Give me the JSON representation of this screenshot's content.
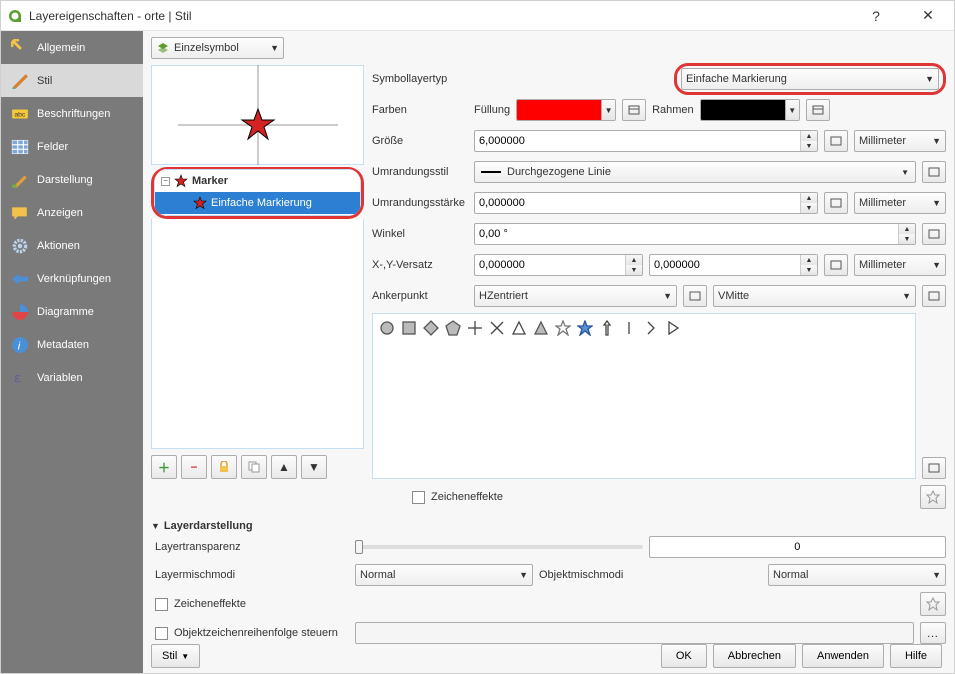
{
  "window_title": "Layereigenschaften - orte | Stil",
  "sidebar": {
    "items": [
      {
        "label": "Allgemein"
      },
      {
        "label": "Stil"
      },
      {
        "label": "Beschriftungen"
      },
      {
        "label": "Felder"
      },
      {
        "label": "Darstellung"
      },
      {
        "label": "Anzeigen"
      },
      {
        "label": "Aktionen"
      },
      {
        "label": "Verknüpfungen"
      },
      {
        "label": "Diagramme"
      },
      {
        "label": "Metadaten"
      },
      {
        "label": "Variablen"
      }
    ],
    "active_index": 1
  },
  "symbol_mode": "Einzelsymbol",
  "tree": {
    "root": "Marker",
    "child": "Einfache Markierung"
  },
  "props": {
    "type_label": "Symbollayertyp",
    "type_value": "Einfache Markierung",
    "colors_label": "Farben",
    "fill_label": "Füllung",
    "fill_color": "#ff0000",
    "stroke_label": "Rahmen",
    "stroke_color": "#000000",
    "size_label": "Größe",
    "size_value": "6,000000",
    "size_unit": "Millimeter",
    "outline_style_label": "Umrandungsstil",
    "outline_style_value": "Durchgezogene Linie",
    "outline_width_label": "Umrandungsstärke",
    "outline_width_value": "0,000000",
    "outline_width_unit": "Millimeter",
    "angle_label": "Winkel",
    "angle_value": "0,00 °",
    "offset_label": "X-,Y-Versatz",
    "offset_x": "0,000000",
    "offset_y": "0,000000",
    "offset_unit": "Millimeter",
    "anchor_label": "Ankerpunkt",
    "anchor_h": "HZentriert",
    "anchor_v": "VMitte"
  },
  "draw_effects": "Zeicheneffekte",
  "layer_rendering": {
    "title": "Layerdarstellung",
    "transparency_label": "Layertransparenz",
    "transparency_value": "0",
    "blend_label": "Layermischmodi",
    "blend_value": "Normal",
    "obj_blend_label": "Objektmischmodi",
    "obj_blend_value": "Normal",
    "draw_effects": "Zeicheneffekte",
    "control_order": "Objektzeichenreihenfolge steuern"
  },
  "stil_button": "Stil",
  "buttons": {
    "ok": "OK",
    "cancel": "Abbrechen",
    "apply": "Anwenden",
    "help": "Hilfe"
  }
}
